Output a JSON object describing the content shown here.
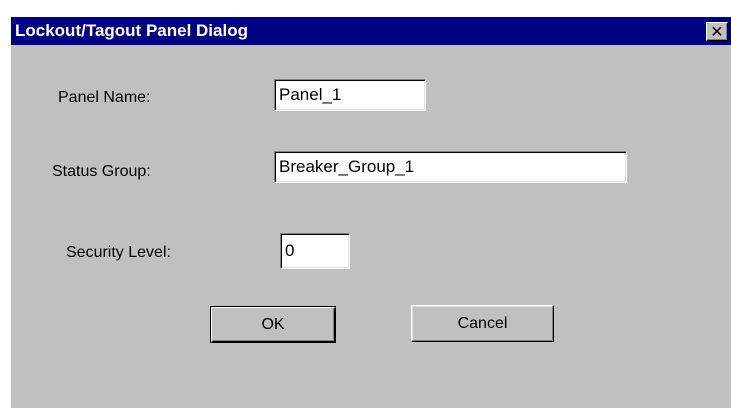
{
  "dialog": {
    "title": "Lockout/Tagout Panel Dialog",
    "close_glyph": "✕"
  },
  "form": {
    "panel_name_label": "Panel Name:",
    "panel_name_value": "Panel_1",
    "status_group_label": "Status Group:",
    "status_group_value": "Breaker_Group_1",
    "security_level_label": "Security Level:",
    "security_level_value": "0"
  },
  "buttons": {
    "ok_label": "OK",
    "cancel_label": "Cancel"
  },
  "icons": {
    "close": "close-icon"
  },
  "colors": {
    "titlebar": "#000080",
    "dialog_face": "#c0c0c0",
    "title_text": "#ffffff"
  }
}
